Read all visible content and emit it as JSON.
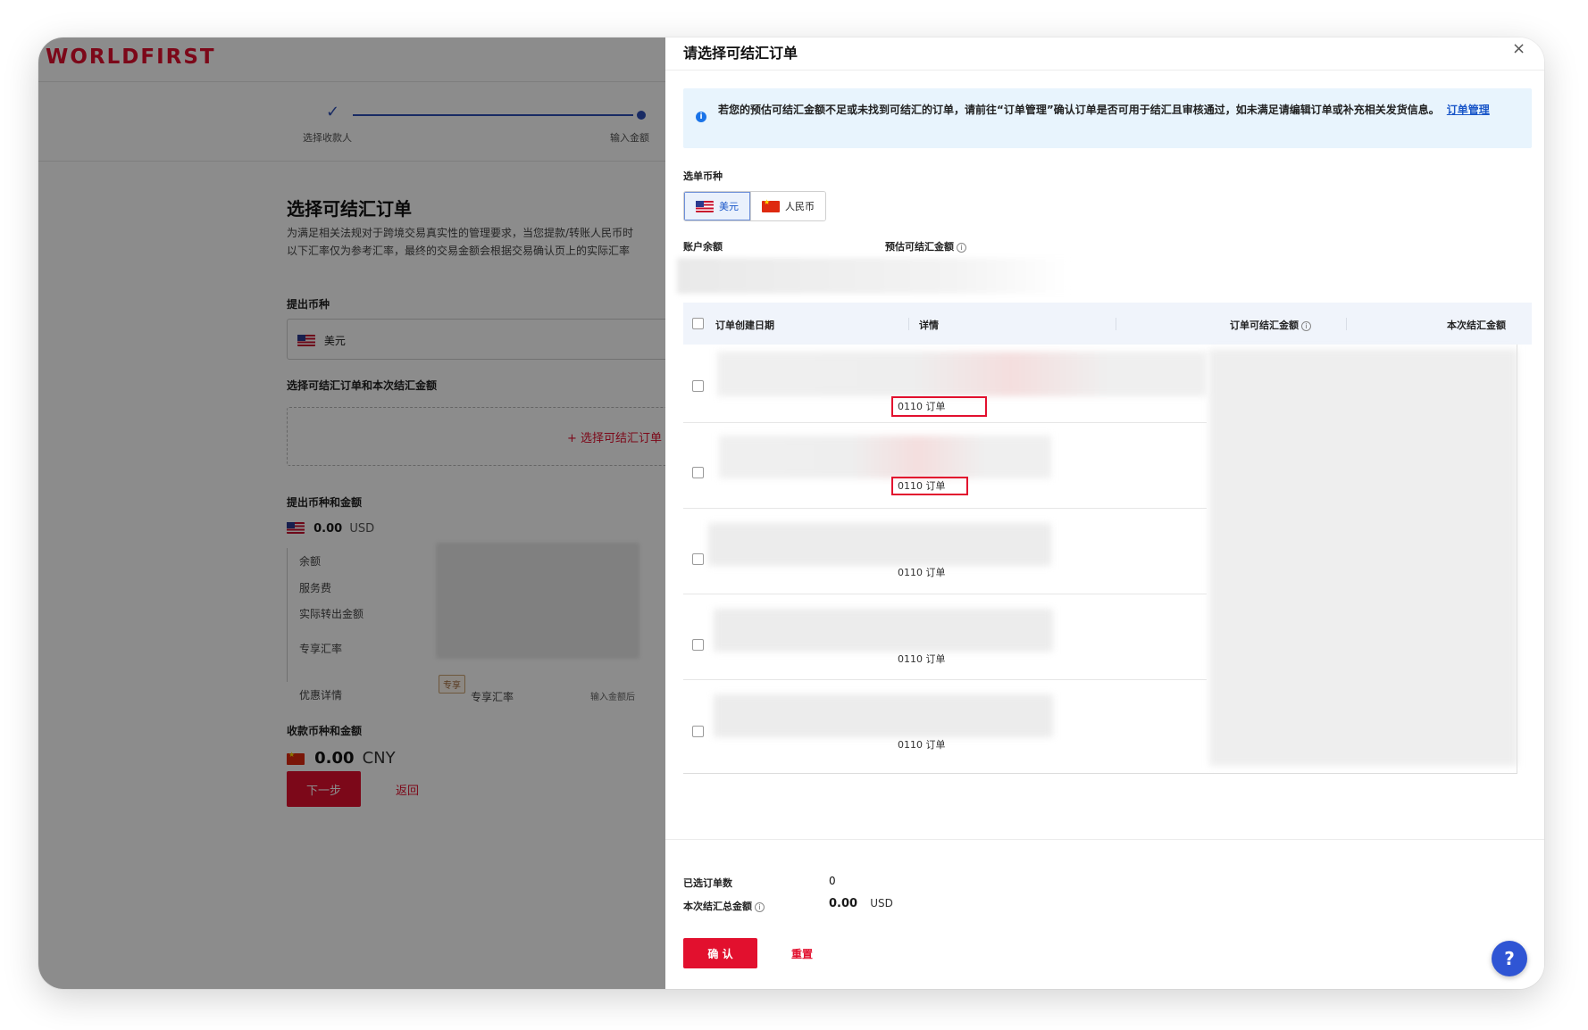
{
  "background": {
    "logo": "WORLDFIRST",
    "steps": [
      "选择收款人",
      "输入金额"
    ],
    "title": "选择可结汇订单",
    "desc_lines": [
      "为满足相关法规对于跨境交易真实性的管理要求，当您提款/转账人民币时",
      "以下汇率仅为参考汇率，最终的交易金额会根据交易确认页上的实际汇率"
    ],
    "withdraw_currency_label": "提出币种",
    "withdraw_currency_value": "美元",
    "select_orders_label": "选择可结汇订单和本次结汇金额",
    "select_orders_button": "+ 选择可结汇订单",
    "withdraw_amount_label": "提出币种和金额",
    "withdraw_amount": "0.00",
    "withdraw_unit": "USD",
    "detail_items": [
      "余额",
      "服务费",
      "实际转出金额",
      "专享汇率"
    ],
    "discount_label": "优惠详情",
    "discount_tag": "专享",
    "discount_text": "专享汇率",
    "discount_hint": "输入金额后",
    "receive_label": "收款币种和金额",
    "receive_amount": "0.00",
    "receive_unit": "CNY",
    "next_button": "下一步",
    "back_link": "返回"
  },
  "drawer": {
    "title": "请选择可结汇订单",
    "close_icon": "×",
    "notice_text": "若您的预估可结汇金额不足或未找到可结汇的订单，请前往“订单管理”确认订单是否可用于结汇且审核通过，如未满足请编辑订单或补充相关发货信息。",
    "notice_link": "订单管理",
    "currency_label": "选单币种",
    "currency_tabs": [
      {
        "label": "美元",
        "flag": "us-flag-icon",
        "active": true
      },
      {
        "label": "人民币",
        "flag": "cn-flag-icon",
        "active": false
      }
    ],
    "balance_label": "账户余额",
    "estimate_label": "预估可结汇金额",
    "info_glyph": "i",
    "table": {
      "columns": [
        "订单创建日期",
        "详情",
        "订单可结汇金额",
        "本次结汇金额"
      ],
      "rows": [
        {
          "order_label": "0110 订单",
          "highlight": true
        },
        {
          "order_label": "0110 订单",
          "highlight": true
        },
        {
          "order_label": "0110 订单",
          "highlight": false
        },
        {
          "order_label": "0110 订单",
          "highlight": false
        },
        {
          "order_label": "0110 订单",
          "highlight": false
        }
      ]
    },
    "footer": {
      "selected_count_label": "已选订单数",
      "selected_count": "0",
      "total_label": "本次结汇总金额",
      "total_amount": "0.00",
      "total_unit": "USD",
      "confirm_button": "确 认",
      "reset_button": "重置"
    },
    "help_glyph": "?"
  },
  "colors": {
    "brand_red": "#e2102e",
    "accent_blue": "#2f55d4",
    "notice_bg": "#e8f4fd"
  }
}
